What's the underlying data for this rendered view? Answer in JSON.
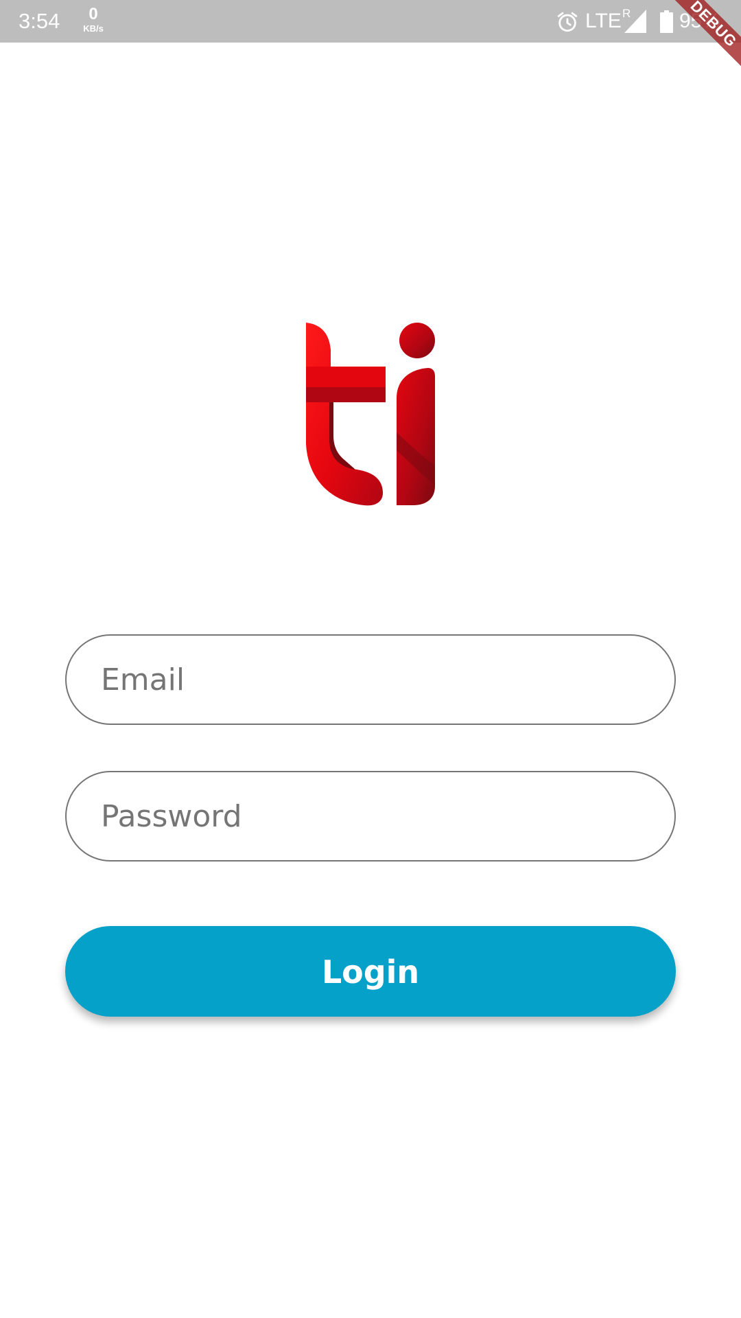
{
  "status_bar": {
    "time": "3:54",
    "net_speed_value": "0",
    "net_speed_unit": "KB/s",
    "network_type": "LTE",
    "roaming_indicator": "R",
    "battery_percent": "95%",
    "icons": [
      "alarm-icon",
      "signal-icon",
      "battery-icon"
    ]
  },
  "debug_banner": "DEBUG",
  "logo": {
    "text": "ti",
    "colors": [
      "#e4060f",
      "#b00613",
      "#7a0a10"
    ]
  },
  "login_form": {
    "email_placeholder": "Email",
    "email_value": "",
    "password_placeholder": "Password",
    "password_value": "",
    "login_label": "Login"
  },
  "colors": {
    "status_bar_bg": "#bdbdbd",
    "primary_button": "#05a1c9",
    "field_border": "#757575",
    "debug_banner": "#a01e1e"
  }
}
